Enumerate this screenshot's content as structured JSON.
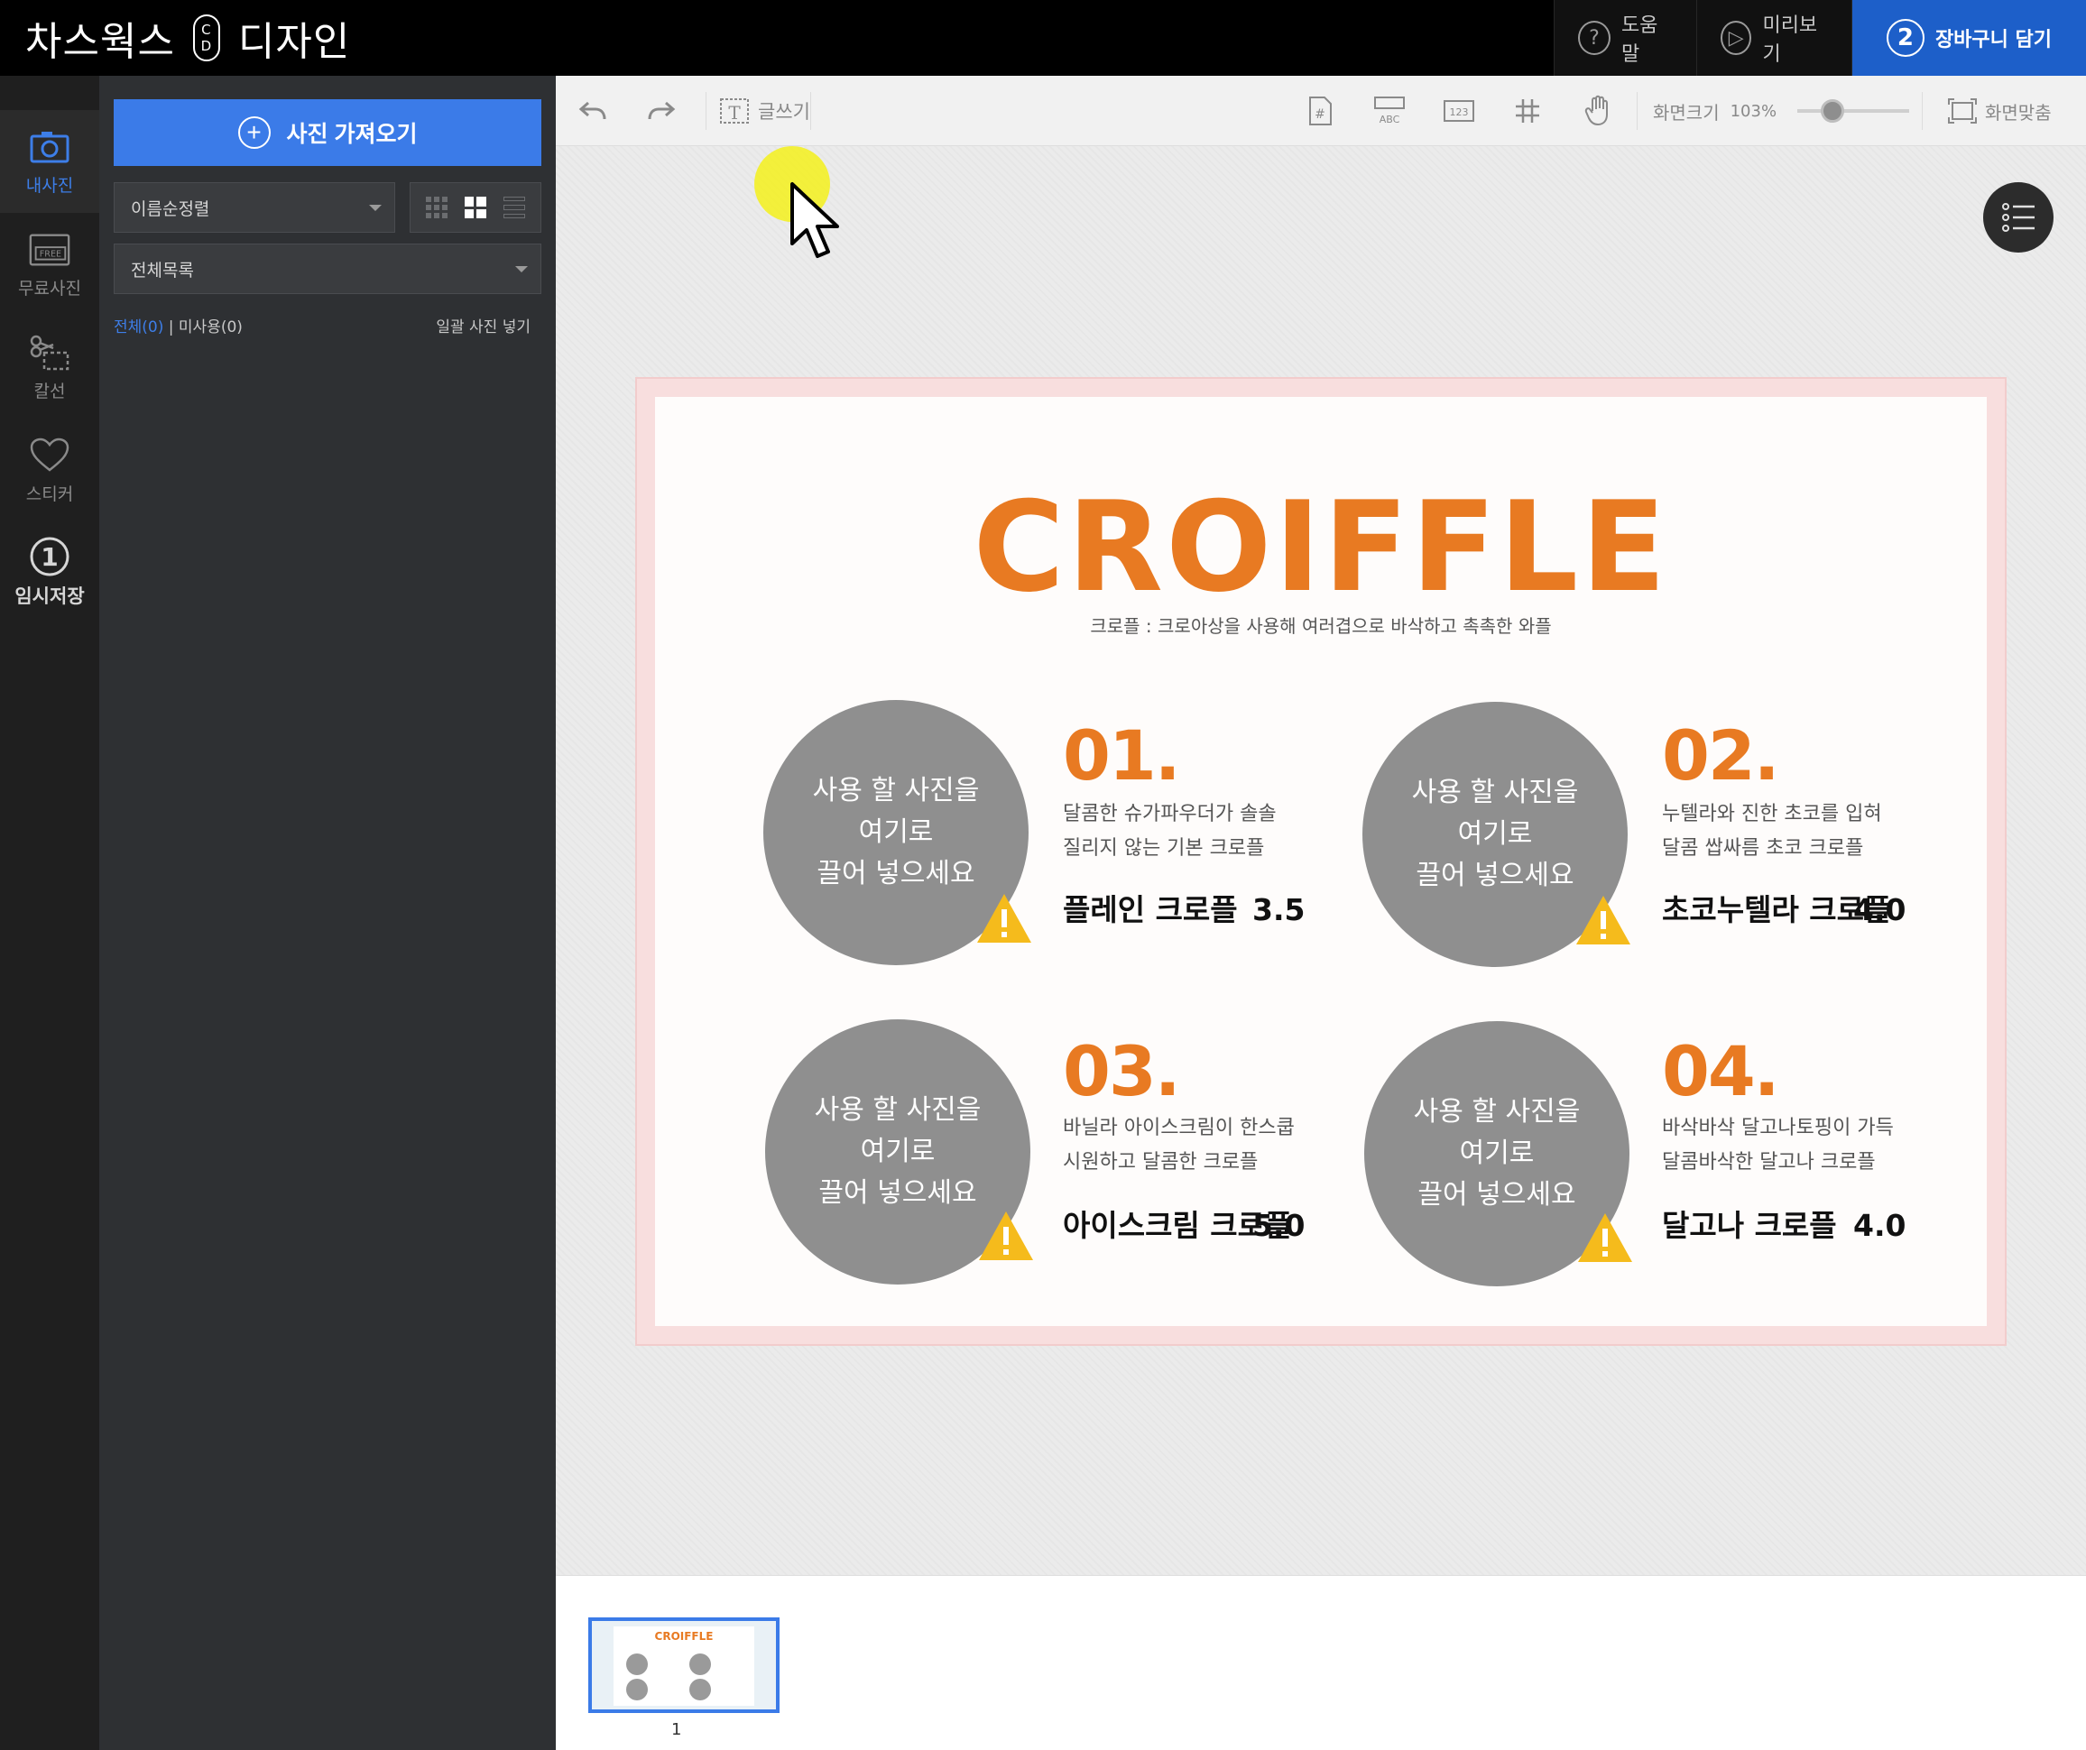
{
  "app": {
    "brand_left": "차스웍스",
    "brand_logo_top": "C",
    "brand_logo_bottom": "D",
    "brand_right": "디자인"
  },
  "top_actions": {
    "help": {
      "icon": "?",
      "label": "도움말"
    },
    "preview": {
      "icon": "▷",
      "label": "미리보기"
    },
    "cart": {
      "icon": "2",
      "label": "장바구니 담기"
    }
  },
  "rail": {
    "items": [
      {
        "label": "내사진",
        "icon": "camera-icon",
        "active": true
      },
      {
        "label": "무료사진",
        "icon": "free-photo-icon",
        "badge": "FREE"
      },
      {
        "label": "칼선",
        "icon": "scissors-icon"
      },
      {
        "label": "스티커",
        "icon": "heart-icon"
      },
      {
        "label": "임시저장",
        "icon": "number-one-icon",
        "badge": "1"
      }
    ]
  },
  "panel": {
    "import_label": "사진 가져오기",
    "sort_value": "이름순정렬",
    "folder_value": "전체목록",
    "filter_all": "전체(0)",
    "filter_sep": "|",
    "filter_unused": "미사용(0)",
    "bulk_insert": "일괄 사진 넣기"
  },
  "toolbar": {
    "text_tool": "글쓰기",
    "zoom_label": "화면크기",
    "zoom_value": "103%",
    "fit_label": "화면맞춤",
    "abc": "ABC",
    "num": "123"
  },
  "design": {
    "title": "CROIFFLE",
    "subtitle": "크로플 : 크로아상을 사용해 여러겹으로 바삭하고 촉촉한 와플",
    "placeholder_text": "사용 할 사진을\n여기로\n끌어 넣으세요",
    "items": [
      {
        "num": "01.",
        "desc": "달콤한 슈가파우더가 솔솔\n질리지 않는 기본 크로플",
        "name": "플레인 크로플",
        "price": "3.5"
      },
      {
        "num": "02.",
        "desc": "누텔라와 진한 초코를 입혀\n달콤 쌉싸름 초코 크로플",
        "name": "초코누텔라 크로플",
        "price": "4.0"
      },
      {
        "num": "03.",
        "desc": "바닐라 아이스크림이 한스쿱\n시원하고 달콤한 크로플",
        "name": "아이스크림 크로플",
        "price": "5.0"
      },
      {
        "num": "04.",
        "desc": "바삭바삭 달고나토핑이 가득\n달콤바삭한 달고나 크로플",
        "name": "달고나 크로플",
        "price": "4.0"
      }
    ]
  },
  "pages": {
    "thumb_title": "CROIFFLE",
    "page_number": "1"
  },
  "colors": {
    "accent": "#3b7be8",
    "title_orange": "#e87a22",
    "placeholder_gray": "#8f8f8f"
  }
}
